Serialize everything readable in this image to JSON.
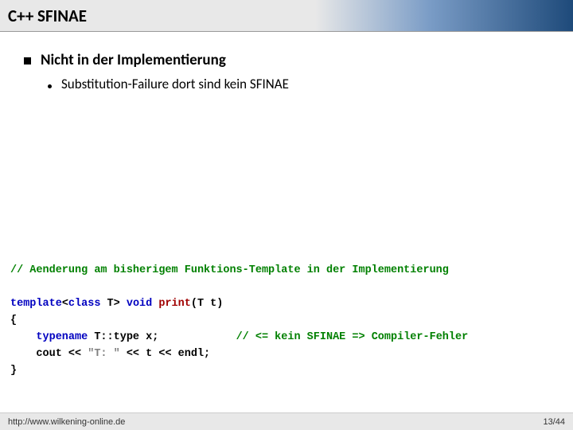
{
  "title": "C++ SFINAE",
  "bullet": {
    "main": "Nicht in der Implementierung",
    "sub": "Substitution-Failure dort sind kein SFINAE"
  },
  "code": {
    "comment_top": "// Aenderung am bisherigem Funktions-Template in der Implementierung",
    "line1_a": "template",
    "line1_b": "<",
    "line1_c": "class",
    "line1_d": " T> ",
    "line1_e": "void",
    "line1_f": " ",
    "line1_g": "print",
    "line1_h": "(T t)",
    "brace_open": "{",
    "line3_a": "    ",
    "line3_b": "typename",
    "line3_c": " T::type x;",
    "line3_pad": "            ",
    "line3_comment": "// <= kein SFINAE => Compiler-Fehler",
    "line4_a": "    cout << ",
    "line4_b": "\"T: \"",
    "line4_c": " << t << endl;",
    "brace_close": "}"
  },
  "footer": {
    "url": "http://www.wilkening-online.de",
    "page": "13/44"
  }
}
